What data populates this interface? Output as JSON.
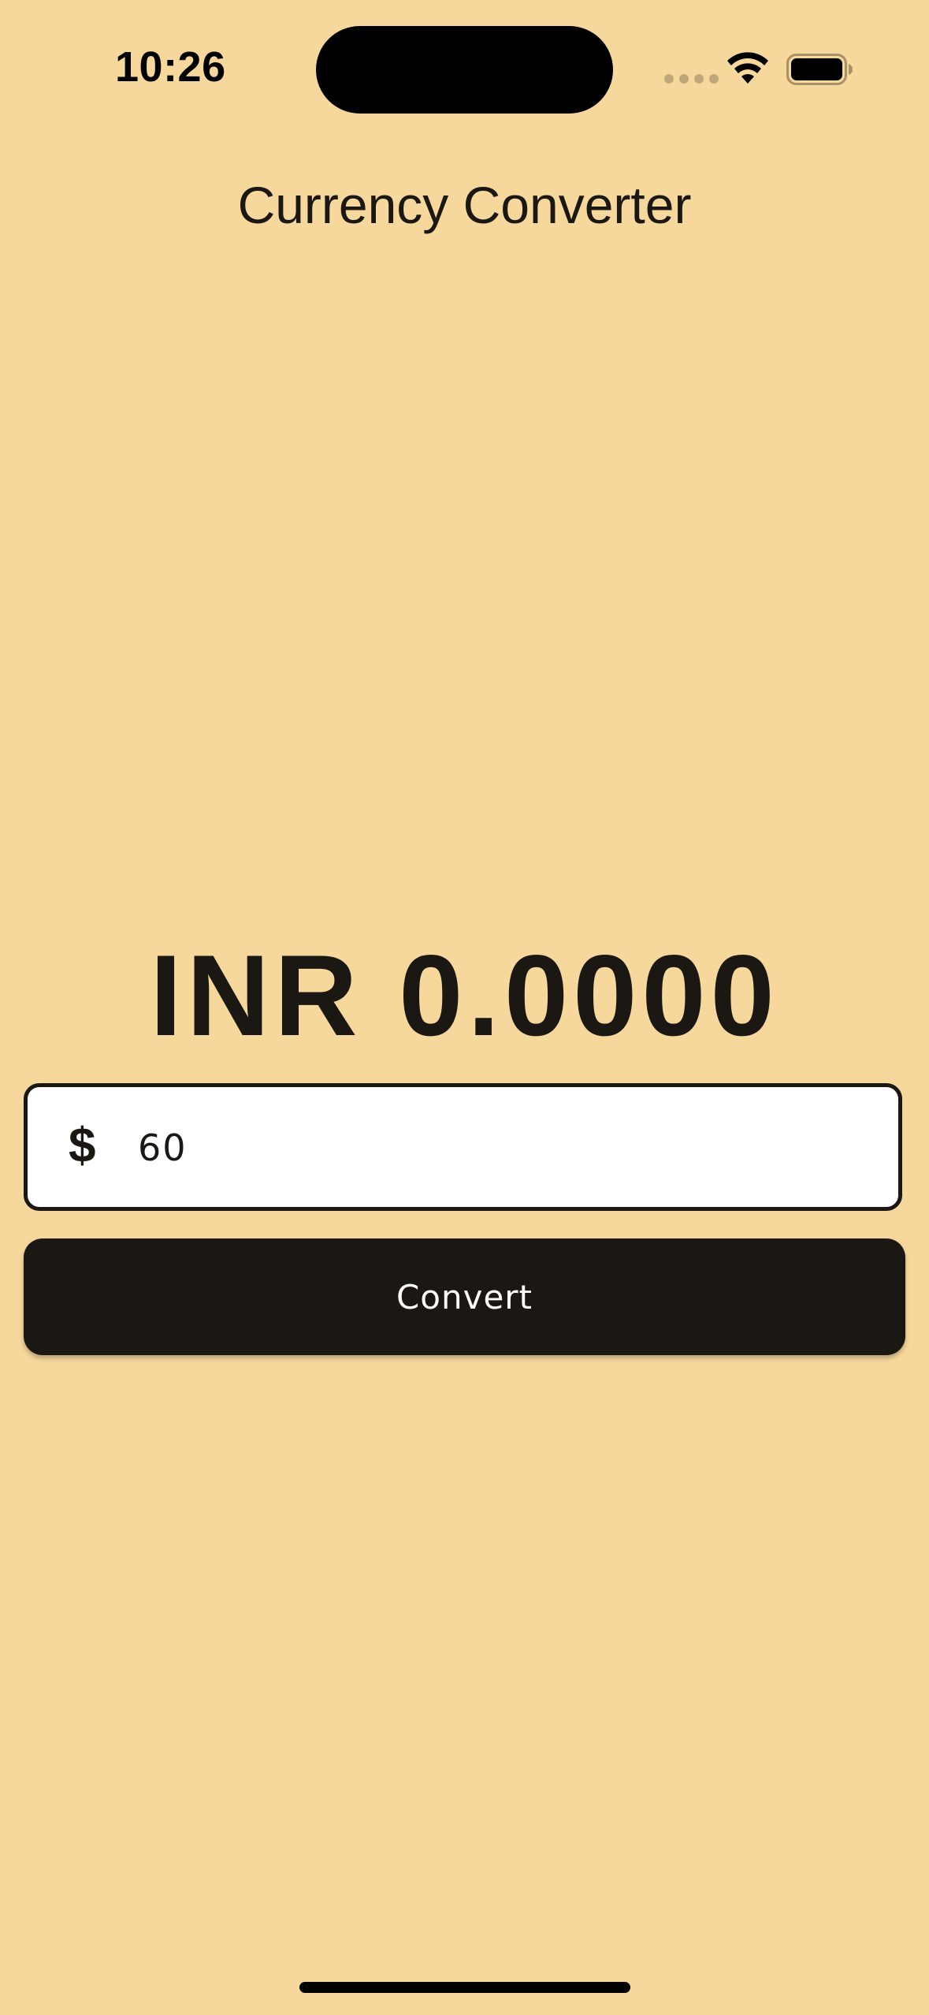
{
  "status_bar": {
    "time": "10:26"
  },
  "app": {
    "title": "Currency Converter",
    "result": "INR 0.0000",
    "input": {
      "prefix_symbol": "$",
      "value": "60"
    },
    "convert_label": "Convert"
  },
  "colors": {
    "background": "#F7D89C",
    "primary": "#1B1712",
    "field_background": "#FFFFFF"
  },
  "icons": {
    "wifi": "wifi-icon",
    "battery": "battery-icon",
    "signal": "cellular-signal-icon"
  }
}
